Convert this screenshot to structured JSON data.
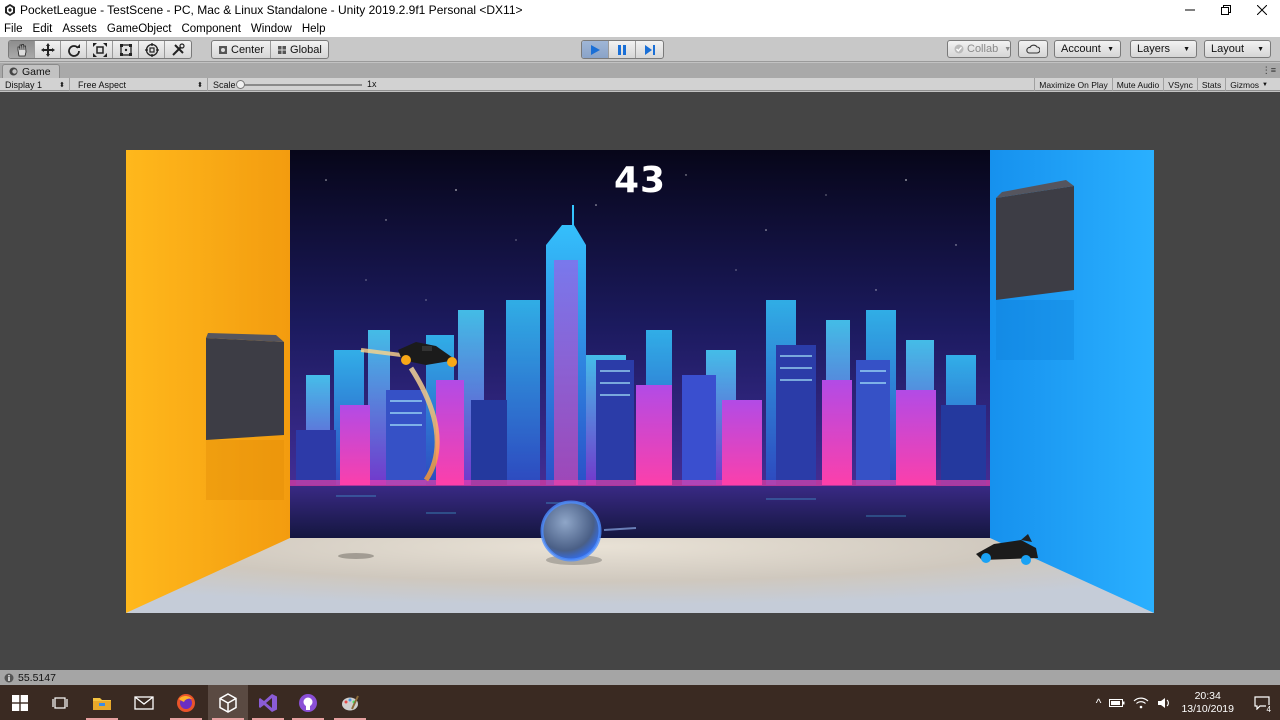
{
  "window": {
    "title": "PocketLeague - TestScene - PC, Mac & Linux Standalone - Unity 2019.2.9f1 Personal <DX11>"
  },
  "menu": [
    "File",
    "Edit",
    "Assets",
    "GameObject",
    "Component",
    "Window",
    "Help"
  ],
  "toolbar": {
    "center_label": "Center",
    "global_label": "Global",
    "collab_label": "Collab",
    "account_label": "Account",
    "layers_label": "Layers",
    "layout_label": "Layout"
  },
  "game_tab": {
    "label": "Game"
  },
  "game_bar": {
    "display": "Display 1",
    "aspect": "Free Aspect",
    "scale_label": "Scale",
    "scale_value": "1x",
    "maximize": "Maximize On Play",
    "mute": "Mute Audio",
    "vsync": "VSync",
    "stats": "Stats",
    "gizmos": "Gizmos"
  },
  "game": {
    "score": "43"
  },
  "status": {
    "message": "55.5147"
  },
  "taskbar": {
    "time": "20:34",
    "date": "13/10/2019",
    "notification_count": "4"
  },
  "colors": {
    "left_wall": "#f7a817",
    "right_wall": "#1aa2f5",
    "play_active": "#8aa3c8",
    "unity_bg": "#454545"
  }
}
